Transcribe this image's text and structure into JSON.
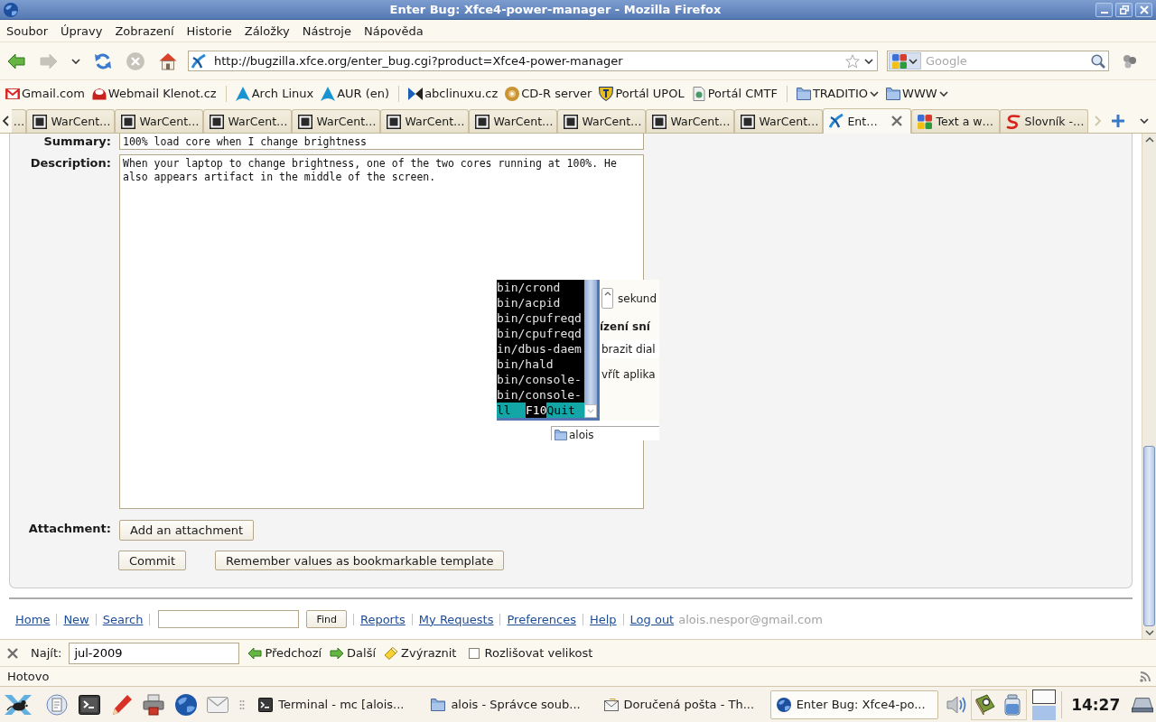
{
  "window": {
    "title": "Enter Bug: Xfce4-power-manager - Mozilla Firefox"
  },
  "menu": [
    "Soubor",
    "Úpravy",
    "Zobrazení",
    "Historie",
    "Záložky",
    "Nástroje",
    "Nápověda"
  ],
  "navigation": {
    "buttons": [
      {
        "kind": "back",
        "disabled": false
      },
      {
        "kind": "forward",
        "disabled": true
      },
      {
        "kind": "history",
        "disabled": false
      },
      {
        "kind": "reload",
        "disabled": false
      },
      {
        "kind": "stop",
        "disabled": true
      },
      {
        "kind": "home",
        "disabled": false
      }
    ],
    "url": "http://bugzilla.xfce.org/enter_bug.cgi?product=Xfce4-power-manager",
    "search": {
      "placeholder": "Google"
    }
  },
  "bookmarks": [
    {
      "kind": "gmail",
      "label": "Gmail.com"
    },
    {
      "kind": "webmail",
      "label": "Webmail Klenot.cz"
    },
    {
      "kind": "separator"
    },
    {
      "kind": "arch",
      "label": "Arch Linux"
    },
    {
      "kind": "arch",
      "label": "AUR (en)"
    },
    {
      "kind": "separator"
    },
    {
      "kind": "abc",
      "label": "abclinuxu.cz"
    },
    {
      "kind": "disc",
      "label": "CD-R server"
    },
    {
      "kind": "shield",
      "label": "Portál UPOL"
    },
    {
      "kind": "page",
      "label": "Portál CMTF"
    },
    {
      "kind": "separator"
    },
    {
      "kind": "folder",
      "label": "TRADITIO"
    },
    {
      "kind": "folder",
      "label": "WWW"
    }
  ],
  "tabs": [
    {
      "kind": "blank",
      "label": "…",
      "selected": false
    },
    {
      "kind": "wc",
      "label": "WarCent…",
      "selected": false
    },
    {
      "kind": "wc",
      "label": "WarCent…",
      "selected": false
    },
    {
      "kind": "wc",
      "label": "WarCent…",
      "selected": false
    },
    {
      "kind": "wc",
      "label": "WarCent…",
      "selected": false
    },
    {
      "kind": "wc",
      "label": "WarCent…",
      "selected": false
    },
    {
      "kind": "wc",
      "label": "WarCent…",
      "selected": false
    },
    {
      "kind": "wc",
      "label": "WarCent…",
      "selected": false
    },
    {
      "kind": "wc",
      "label": "WarCent…",
      "selected": false
    },
    {
      "kind": "wc",
      "label": "WarCent…",
      "selected": false
    },
    {
      "kind": "bug",
      "label": "Ent…",
      "selected": true
    },
    {
      "kind": "google",
      "label": "Text a w…",
      "selected": false
    },
    {
      "kind": "slovnik",
      "label": "Slovník -…",
      "selected": false
    }
  ],
  "form": {
    "summary": {
      "label": "Summary:",
      "value": "100% load core when I change brightness"
    },
    "description": {
      "label": "Description:",
      "value": "When your laptop to change brightness, one of the two cores running at 100%. He also appears artifact in the middle of the screen."
    },
    "artifact": {
      "terminal_lines": [
        "bin/crond",
        "bin/acpid",
        "bin/cpufreqd",
        "bin/cpufreqd",
        "in/dbus-daem",
        "bin/hald",
        "bin/console-",
        "bin/console-"
      ],
      "key_bar": {
        "cut_label": "ll",
        "key": "F10",
        "label": "Quit"
      },
      "dialog_lines": [
        {
          "kind": "spin",
          "text": "sekund"
        },
        {
          "kind": "heading",
          "text": "ízení sní"
        },
        {
          "kind": "field",
          "text": "brazit dial"
        },
        {
          "kind": "plain",
          "text": "vřít aplika"
        }
      ],
      "folder_label": "alois"
    },
    "attachment": {
      "label": "Attachment:",
      "button": "Add an attachment"
    },
    "buttons": [
      "Commit",
      "Remember values as bookmarkable template"
    ]
  },
  "footer": {
    "links_left": [
      "Home",
      "New",
      "Search"
    ],
    "find_button": "Find",
    "links_right": [
      "Reports",
      "My Requests",
      "Preferences",
      "Help",
      "Log out"
    ],
    "user": "alois.nespor@gmail.com"
  },
  "find_bar": {
    "label": "Najít:",
    "value": "jul-2009",
    "buttons": [
      {
        "kind": "previous",
        "label": "Předchozí"
      },
      {
        "kind": "next",
        "label": "Další"
      },
      {
        "kind": "highlight",
        "label": "Zvýraznit"
      }
    ],
    "match_case": {
      "label": "Rozlišovat velikost",
      "checked": false
    }
  },
  "status_bar": {
    "text": "Hotovo"
  },
  "taskbar": {
    "tasks": [
      {
        "kind": "terminal",
        "label": "Terminal - mc [alois...",
        "selected": false
      },
      {
        "kind": "folder",
        "label": "alois - Správce soub...",
        "selected": false
      },
      {
        "kind": "mail",
        "label": "Doručená pošta - Th...",
        "selected": false
      },
      {
        "kind": "browser",
        "label": "Enter Bug: Xfce4-po...",
        "selected": true
      }
    ],
    "workspaces": [
      {
        "selected": false
      },
      {
        "selected": true
      }
    ],
    "clock": "14:27"
  }
}
